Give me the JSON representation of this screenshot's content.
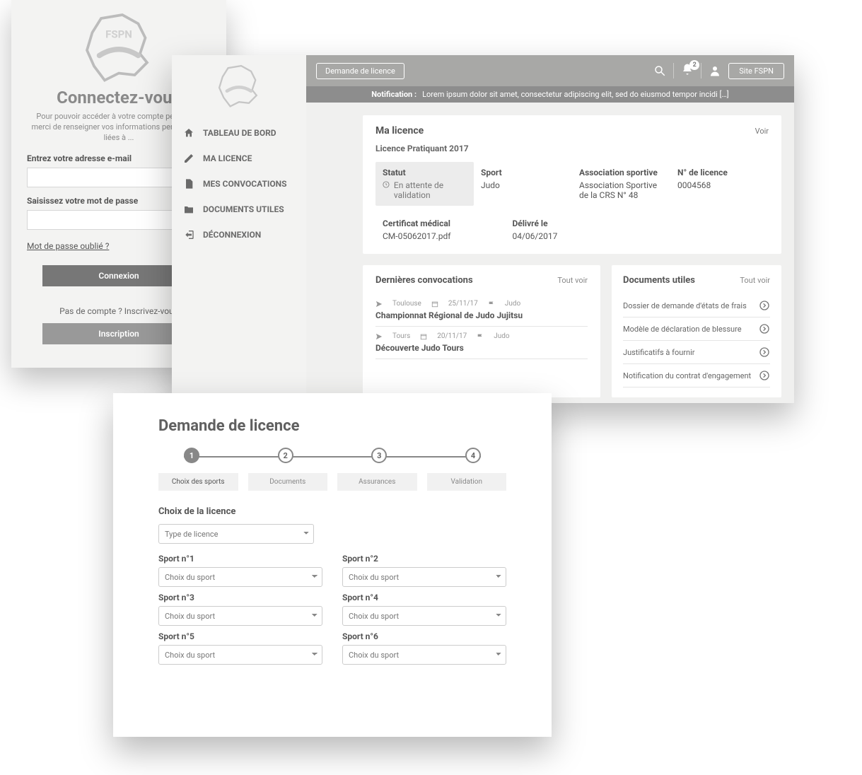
{
  "login": {
    "title": "Connectez-vous",
    "lead": "Pour pouvoir accéder à votre compte personnel, merci de renseigner vos informations personnelles liées à ...",
    "email_label": "Entrez votre adresse e-mail",
    "password_label": "Saisissez votre mot de passe",
    "forgot": "Mot de passe oublié ?",
    "signin_btn": "Connexion",
    "noacct": "Pas de compte ? Inscrivez-vous",
    "signup_btn": "Inscription",
    "logo_text": "FSPN"
  },
  "dash": {
    "nav": {
      "dashboard": "TABLEAU DE BORD",
      "licence": "MA LICENCE",
      "convocations": "MES CONVOCATIONS",
      "documents": "DOCUMENTS UTILES",
      "logout": "DÉCONNEXION"
    },
    "topbar": {
      "request": "Demande de licence",
      "site": "Site FSPN",
      "notif_count": "2"
    },
    "notif": {
      "label": "Notification :",
      "text": "Lorem ipsum dolor sit amet, consectetur adipiscing elit, sed do eiusmod tempor incidi […]"
    },
    "licence": {
      "title": "Ma licence",
      "see": "Voir",
      "sub": "Licence Pratiquant 2017",
      "cols": {
        "status_h": "Statut",
        "status_v": "En attente de validation",
        "sport_h": "Sport",
        "sport_v": "Judo",
        "assoc_h": "Association sportive",
        "assoc_v": "Association Sportive de la CRS N° 48",
        "num_h": "N° de licence",
        "num_v": "0004568",
        "cert_h": "Certificat médical",
        "cert_v": "CM-05062017.pdf",
        "deliv_h": "Délivré le",
        "deliv_v": "04/06/2017"
      }
    },
    "convs": {
      "title": "Dernières convocations",
      "seeall": "Tout voir",
      "items": [
        {
          "loc": "Toulouse",
          "date": "25/11/17",
          "sport": "Judo",
          "title": "Championnat Régional de Judo Jujitsu"
        },
        {
          "loc": "Tours",
          "date": "20/11/17",
          "sport": "Judo",
          "title": "Découverte Judo Tours"
        }
      ]
    },
    "docs": {
      "title": "Documents utiles",
      "seeall": "Tout voir",
      "items": [
        "Dossier de demande d'états de frais",
        "Modèle de déclaration de blessure",
        "Justificatifs à fournir",
        "Notification du contrat d'engagement"
      ]
    }
  },
  "wizard": {
    "title": "Demande de licence",
    "steps": [
      "1",
      "2",
      "3",
      "4"
    ],
    "step_labels": [
      "Choix des sports",
      "Documents",
      "Assurances",
      "Validation"
    ],
    "section": "Choix de la licence",
    "licence_select": "Type de licence",
    "sport_prefix": "Sport n°",
    "sport_select": "Choix du sport"
  }
}
